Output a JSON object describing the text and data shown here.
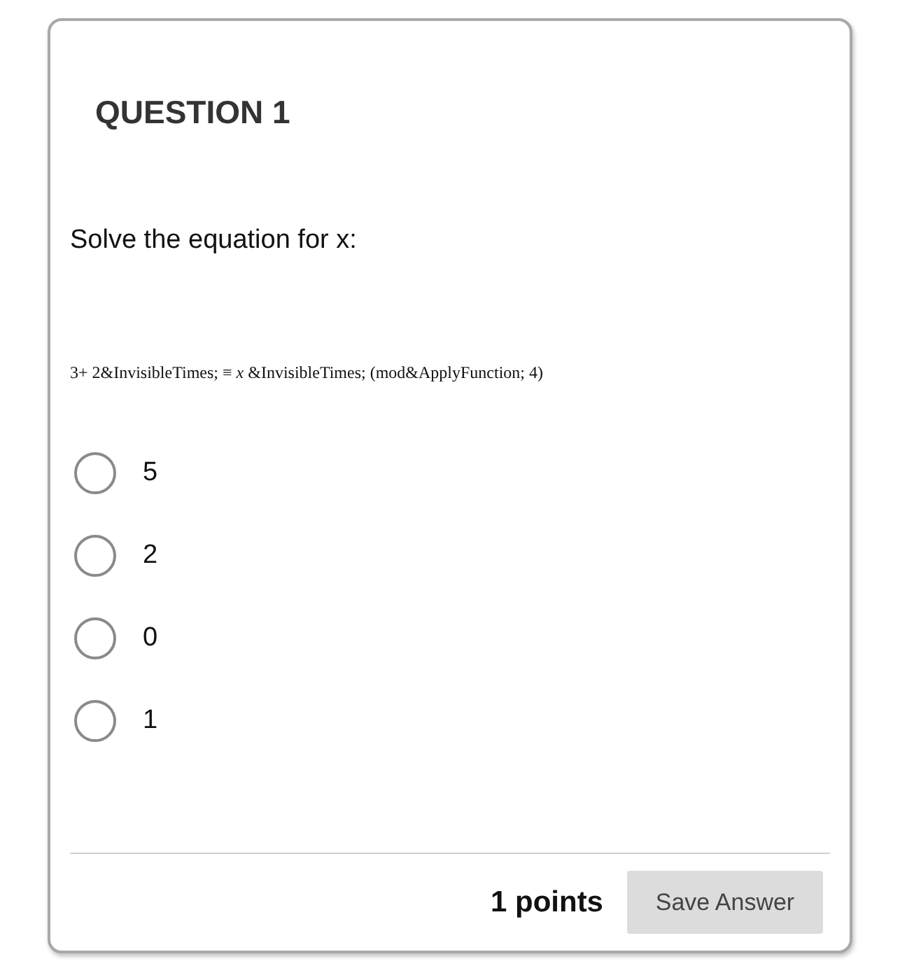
{
  "question": {
    "title": "QUESTION 1",
    "prompt": "Solve the equation for x:",
    "equation": "3+ 2&InvisibleTimes; ≡ *x* &InvisibleTimes; (mod&ApplyFunction; 4)"
  },
  "options": [
    {
      "label": "5",
      "selected": false
    },
    {
      "label": "2",
      "selected": false
    },
    {
      "label": "0",
      "selected": false
    },
    {
      "label": "1",
      "selected": false
    }
  ],
  "footer": {
    "points": "1 points",
    "button": "Save Answer"
  }
}
